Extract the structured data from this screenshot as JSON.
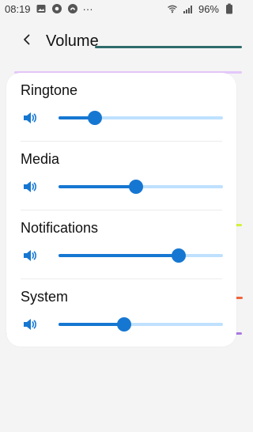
{
  "status_bar": {
    "time": "08:19",
    "more": "···",
    "battery_percent": "96%"
  },
  "header": {
    "title": "Volume"
  },
  "sections": [
    {
      "label": "Ringtone",
      "level": 0.22
    },
    {
      "label": "Media",
      "level": 0.47
    },
    {
      "label": "Notifications",
      "level": 0.73
    },
    {
      "label": "System",
      "level": 0.4
    }
  ],
  "colors": {
    "accent": "#1677d2",
    "track": "#bfe1ff",
    "background": "#f4f4f4",
    "card": "#ffffff"
  },
  "icons": {
    "back": "chevron-left-icon",
    "volume": "speaker-volume-icon"
  }
}
